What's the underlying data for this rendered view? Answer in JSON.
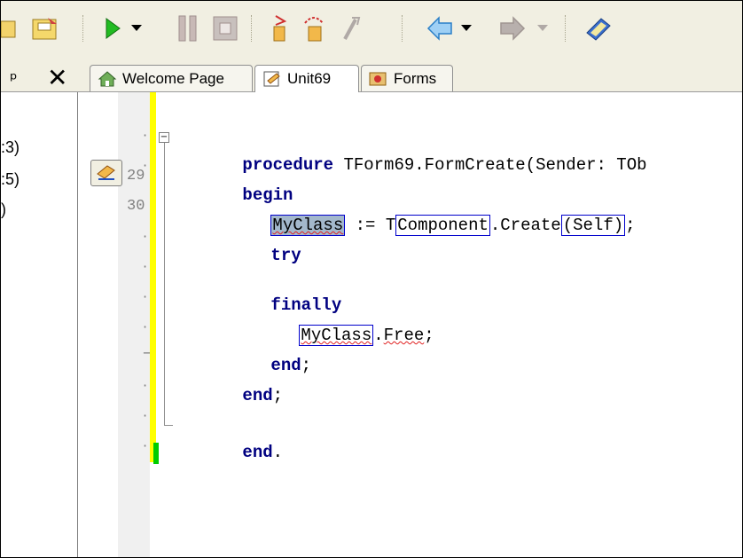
{
  "toolbar": {
    "buttons": [
      "open-icon",
      "save-icon",
      "run-icon",
      "run-dropdown-icon",
      "pause-icon",
      "stop-icon",
      "step-into-icon",
      "step-over-icon",
      "step-out-icon",
      "back-icon",
      "back-dropdown-icon",
      "forward-icon",
      "forward-dropdown-icon",
      "help-book-icon"
    ]
  },
  "panel": {
    "pin_glyph": "ᵖ",
    "close_glyph": "✕",
    "lines": [
      ":3)",
      ":5)",
      ")"
    ]
  },
  "tabs": [
    {
      "label": "Welcome Page",
      "icon": "home-icon",
      "active": false
    },
    {
      "label": "Unit69",
      "icon": "unit-icon",
      "active": true
    },
    {
      "label": "Forms",
      "icon": "forms-icon",
      "active": false
    }
  ],
  "editor": {
    "line_numbers": [
      "29",
      "30"
    ],
    "code": {
      "l1_kw": "procedure",
      "l1_rest": " TForm69.FormCreate(Sender: TOb",
      "l2_kw": "begin",
      "l3_myclass": "MyClass",
      "l3_assign": " := T",
      "l3_component": "Component",
      "l3_create": ".Create",
      "l3_self": "(Self)",
      "l3_end": ";",
      "l4_kw": "try",
      "l6_kw": "finally",
      "l7_myclass": "MyClass",
      "l7_dot": ".",
      "l7_free": "Free",
      "l7_end": ";",
      "l8_kw": "end",
      "l8_end": ";",
      "l9_kw": "end",
      "l9_end": ";",
      "l11_kw": "end",
      "l11_end": "."
    }
  },
  "colors": {
    "keyword": "#000080",
    "change_bar": "#ffff00",
    "saved_bar": "#00cc00",
    "highlight_border": "#0000cc"
  }
}
